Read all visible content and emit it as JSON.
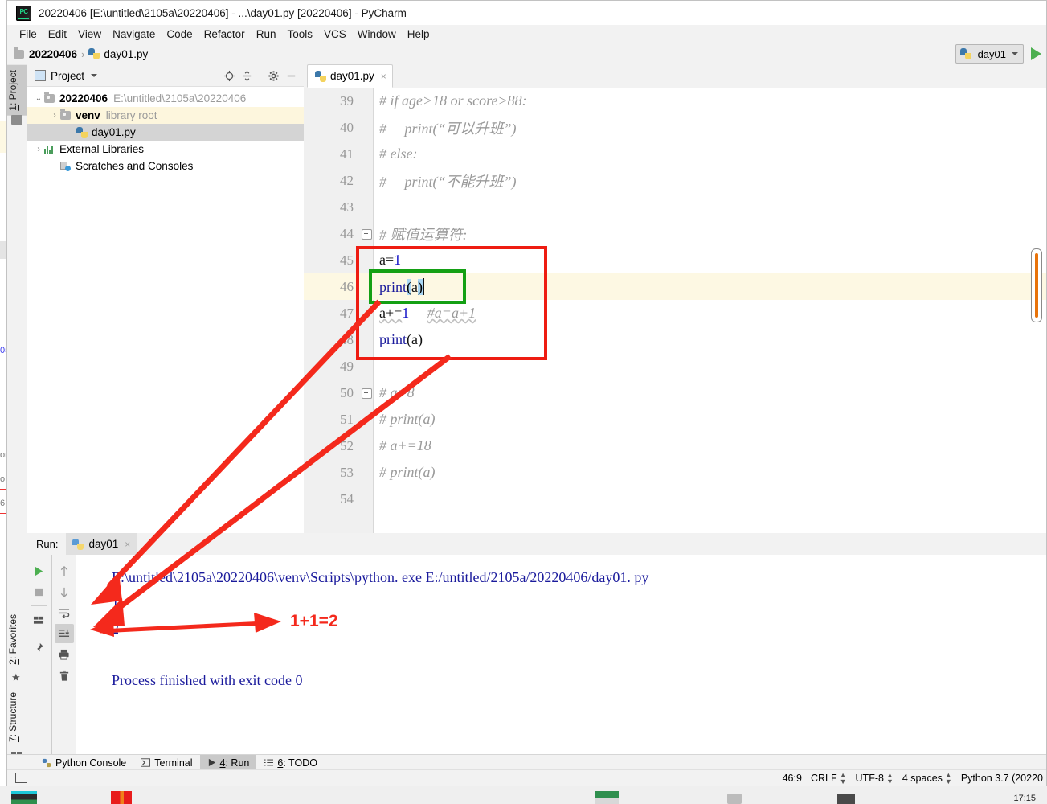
{
  "window": {
    "title": "20220406 [E:\\untitled\\2105a\\20220406] - ...\\day01.py [20220406] - PyCharm",
    "minimize": "—",
    "app_icon": "pycharm-logo"
  },
  "menubar": [
    {
      "pre": "",
      "key": "F",
      "post": "ile"
    },
    {
      "pre": "",
      "key": "E",
      "post": "dit"
    },
    {
      "pre": "",
      "key": "V",
      "post": "iew"
    },
    {
      "pre": "",
      "key": "N",
      "post": "avigate"
    },
    {
      "pre": "",
      "key": "C",
      "post": "ode"
    },
    {
      "pre": "",
      "key": "R",
      "post": "efactor"
    },
    {
      "pre": "R",
      "key": "u",
      "post": "n"
    },
    {
      "pre": "",
      "key": "T",
      "post": "ools"
    },
    {
      "pre": "VC",
      "key": "S",
      "post": ""
    },
    {
      "pre": "",
      "key": "W",
      "post": "indow"
    },
    {
      "pre": "",
      "key": "H",
      "post": "elp"
    }
  ],
  "navbar": {
    "project_crumb": "20220406",
    "separator": "›",
    "file_crumb": "day01.py",
    "run_config_label": "day01",
    "run_button": "run-arrow"
  },
  "toolstrip": {
    "project_tab": {
      "num": "1",
      "label": ": Project"
    },
    "favorites_tab": {
      "num": "2",
      "label": ": Favorites"
    },
    "structure_tab": {
      "num": "7",
      "label": ": Structure"
    }
  },
  "project_panel": {
    "title": "Project",
    "actions": [
      "locate-icon",
      "collapse-all-icon",
      "settings-gear-icon",
      "hide-icon"
    ],
    "tree": [
      {
        "name": "20220406",
        "path": "E:\\untitled\\2105a\\20220406",
        "arrow": "⌄",
        "icon": "folder-icon",
        "indent": 0,
        "state": "normal",
        "bold": true
      },
      {
        "name": "venv",
        "path": "library root",
        "arrow": "›",
        "icon": "folder-icon",
        "indent": 1,
        "state": "highlight",
        "bold": true
      },
      {
        "name": "day01.py",
        "path": "",
        "arrow": "",
        "icon": "python-file-icon",
        "indent": 2,
        "state": "selected",
        "bold": false
      },
      {
        "name": "External Libraries",
        "path": "",
        "arrow": "›",
        "icon": "library-icon",
        "indent": 0,
        "state": "normal",
        "bold": false
      },
      {
        "name": "Scratches and Consoles",
        "path": "",
        "arrow": "",
        "icon": "scratches-icon",
        "indent": 1,
        "state": "normal",
        "bold": false
      }
    ]
  },
  "editor": {
    "tab_label": "day01.py",
    "tab_close": "×",
    "lines": [
      {
        "num": "39",
        "fold": false,
        "html": "<span class='cmt'># if age&gt;18 or score&gt;88:</span>"
      },
      {
        "num": "40",
        "fold": false,
        "html": "<span class='cmt'>#     print(“可以升班”)</span>"
      },
      {
        "num": "41",
        "fold": false,
        "html": "<span class='cmt'># else:</span>"
      },
      {
        "num": "42",
        "fold": false,
        "html": "<span class='cmt'>#     print(“不能升班”)</span>"
      },
      {
        "num": "43",
        "fold": false,
        "html": ""
      },
      {
        "num": "44",
        "fold": true,
        "html": "<span class='cmt'># 赋值运算符:</span>"
      },
      {
        "num": "45",
        "fold": false,
        "html": "<span class='plain'>a=</span><span class='num'>1</span>"
      },
      {
        "num": "46",
        "fold": false,
        "html": "<span class='kw'>print</span><span class='paren-hl'>(</span><span class='plain'>a</span><span class='paren-hl'>)</span><span class='caret-bar'></span>"
      },
      {
        "num": "47",
        "fold": false,
        "html": "<span class='plain squig'>a+=</span><span class='num'>1</span><span class='plain'>     </span><span class='cmt squig'>#a=a+1</span>"
      },
      {
        "num": "48",
        "fold": false,
        "html": "<span class='kw'>print</span><span class='plain'>(a)</span>"
      },
      {
        "num": "49",
        "fold": false,
        "html": ""
      },
      {
        "num": "50",
        "fold": true,
        "html": "<span class='cmt'># a=8</span>"
      },
      {
        "num": "51",
        "fold": false,
        "html": "<span class='cmt'># print(a)</span>"
      },
      {
        "num": "52",
        "fold": false,
        "html": "<span class='cmt'># a+=18</span>"
      },
      {
        "num": "53",
        "fold": false,
        "html": "<span class='cmt'># print(a)</span>"
      },
      {
        "num": "54",
        "fold": false,
        "html": ""
      }
    ],
    "highlight_line": "46"
  },
  "run_panel": {
    "label": "Run:",
    "tab_label": "day01",
    "tab_close": "×",
    "side_actions_left": [
      "rerun-icon",
      "stop-icon",
      "layout-icon",
      "pin-icon"
    ],
    "side_actions_right": [
      "up-arrow-icon",
      "down-arrow-icon",
      "soft-wrap-icon",
      "scroll-to-end-icon",
      "print-icon",
      "trash-icon"
    ],
    "console_text": "E:\\untitled\\2105a\\20220406\\venv\\Scripts\\python. exe E:/untitled/2105a/20220406/day01. py\n1\n2\n\nProcess finished with exit code 0"
  },
  "bottom_bar": [
    {
      "icon": "python-console-icon",
      "pre": "Python Console",
      "key": "",
      "post": "",
      "active": false
    },
    {
      "icon": "terminal-icon",
      "pre": "Terminal",
      "key": "",
      "post": "",
      "active": false
    },
    {
      "icon": "run-play-icon",
      "pre": "",
      "key": "4",
      "post": ": Run",
      "active": true
    },
    {
      "icon": "todo-icon",
      "pre": "",
      "key": "6",
      "post": ": TODO",
      "active": false
    }
  ],
  "statusbar": {
    "caret_position": "46:9",
    "line_separator": "CRLF",
    "encoding": "UTF-8",
    "indent": "4 spaces",
    "interpreter": "Python 3.7 (20220"
  },
  "annotations": {
    "formula": "1+1=2",
    "color": "#f4291c",
    "code_box_color": "#ee1c12",
    "focus_box_color": "#14a014"
  },
  "taskbar": {
    "clock": "17:15"
  }
}
